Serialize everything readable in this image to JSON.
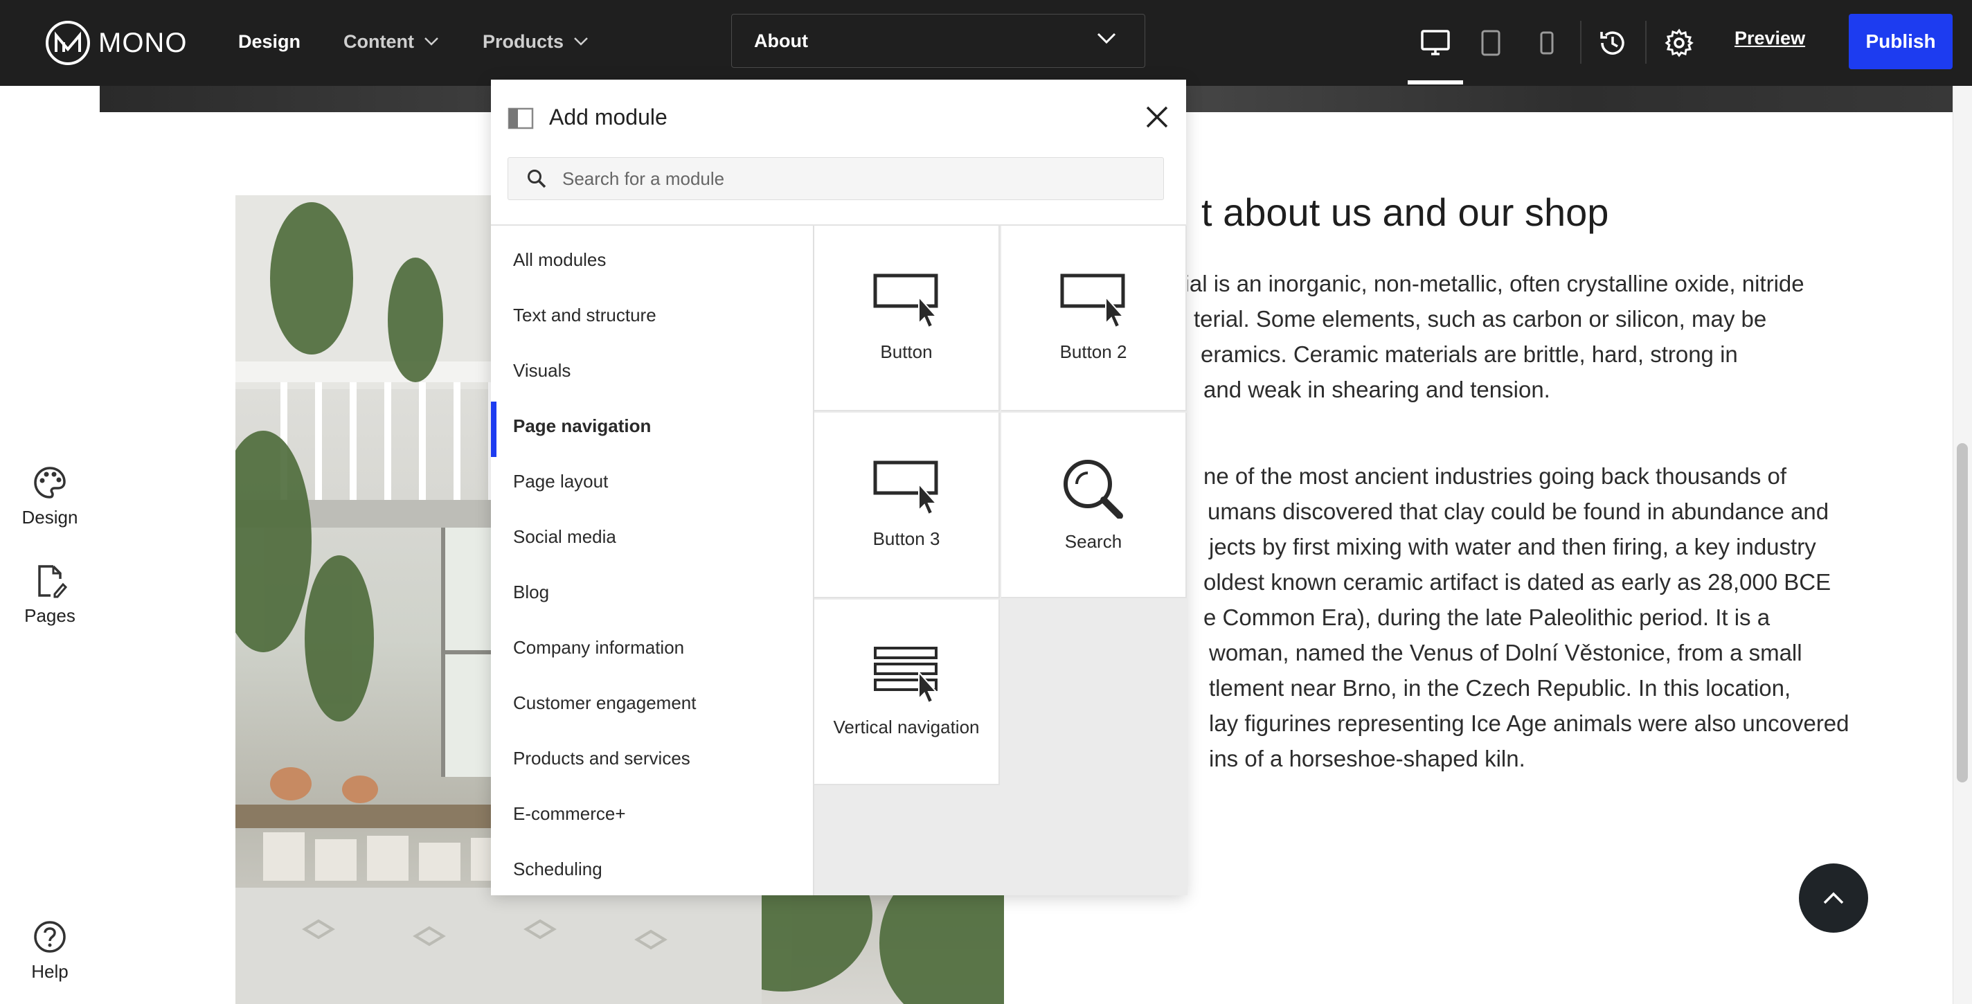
{
  "topbar": {
    "logo_text": "MONO",
    "nav": {
      "design": "Design",
      "content": "Content",
      "products": "Products"
    },
    "page_select": "About",
    "preview": "Preview",
    "publish": "Publish",
    "device_icons": [
      "desktop-icon",
      "tablet-icon",
      "mobile-icon"
    ]
  },
  "rail": {
    "design": "Design",
    "pages": "Pages",
    "help": "Help"
  },
  "page": {
    "heading": "t about us and our shop",
    "para1": [
      "terial is an inorganic, non-metallic, often crystalline oxide, nitride",
      "terial. Some elements, such as carbon or silicon, may be",
      "eramics. Ceramic materials are brittle, hard, strong in",
      "and weak in shearing and tension."
    ],
    "para2": [
      "ne of the most ancient industries going back thousands of",
      "umans discovered that clay could be found in abundance and",
      "jects by first mixing with water and then firing, a key industry",
      " oldest known ceramic artifact is dated as early as 28,000 BCE",
      "e Common Era), during the late Paleolithic period. It is a",
      "woman, named the Venus of Dolní Věstonice, from a small",
      "tlement near Brno, in the Czech Republic. In this location,",
      "lay figurines representing Ice Age animals were also uncovered",
      "ins of a horseshoe-shaped kiln."
    ]
  },
  "modal": {
    "title": "Add module",
    "search_placeholder": "Search for a module",
    "categories": [
      "All modules",
      "Text and structure",
      "Visuals",
      "Page navigation",
      "Page layout",
      "Social media",
      "Blog",
      "Company information",
      "Customer engagement",
      "Products and services",
      "E-commerce+",
      "Scheduling"
    ],
    "active_category": "Page navigation",
    "modules": [
      {
        "label": "Button",
        "icon": "button-cursor-icon"
      },
      {
        "label": "Button 2",
        "icon": "button-cursor-icon"
      },
      {
        "label": "Button 3",
        "icon": "button-cursor-icon"
      },
      {
        "label": "Search",
        "icon": "magnifier-icon"
      },
      {
        "label": "Vertical navigation",
        "icon": "vertical-navigation-icon"
      }
    ]
  },
  "colors": {
    "topbar_bg": "#1f1f1f",
    "accent": "#1d3cf0",
    "back_to_top_bg": "#1f2428"
  }
}
